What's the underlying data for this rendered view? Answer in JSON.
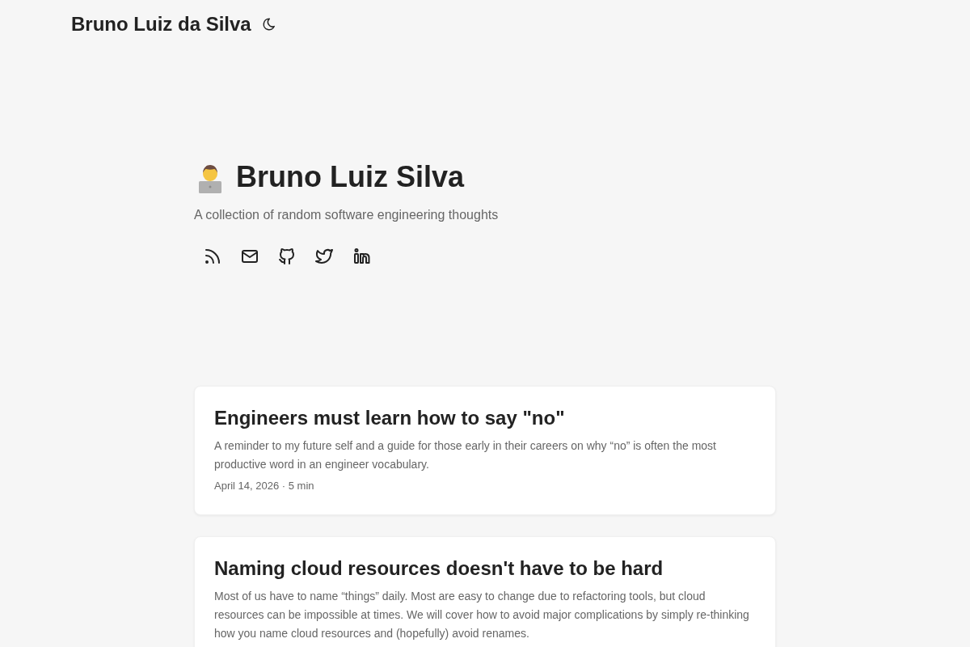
{
  "header": {
    "title": "Bruno Luiz da Silva"
  },
  "hero": {
    "title": "Bruno Luiz Silva",
    "subtitle": "A collection of random software engineering thoughts",
    "social_links": [
      {
        "kind": "rss"
      },
      {
        "kind": "email"
      },
      {
        "kind": "github"
      },
      {
        "kind": "twitter"
      },
      {
        "kind": "linkedin"
      }
    ]
  },
  "posts": [
    {
      "title": "Engineers must learn how to say \"no\"",
      "description": "A reminder to my future self and a guide for those early in their careers on why “no” is often the most productive word in an engineer vocabulary.",
      "meta": "April 14, 2026 · 5 min"
    },
    {
      "title": "Naming cloud resources doesn't have to be hard",
      "description": "Most of us have to name “things” daily. Most are easy to change due to refactoring tools, but cloud resources can be impossible at times. We will cover how to avoid major complications by simply re-thinking how you name cloud resources and (hopefully) avoid renames."
    }
  ]
}
